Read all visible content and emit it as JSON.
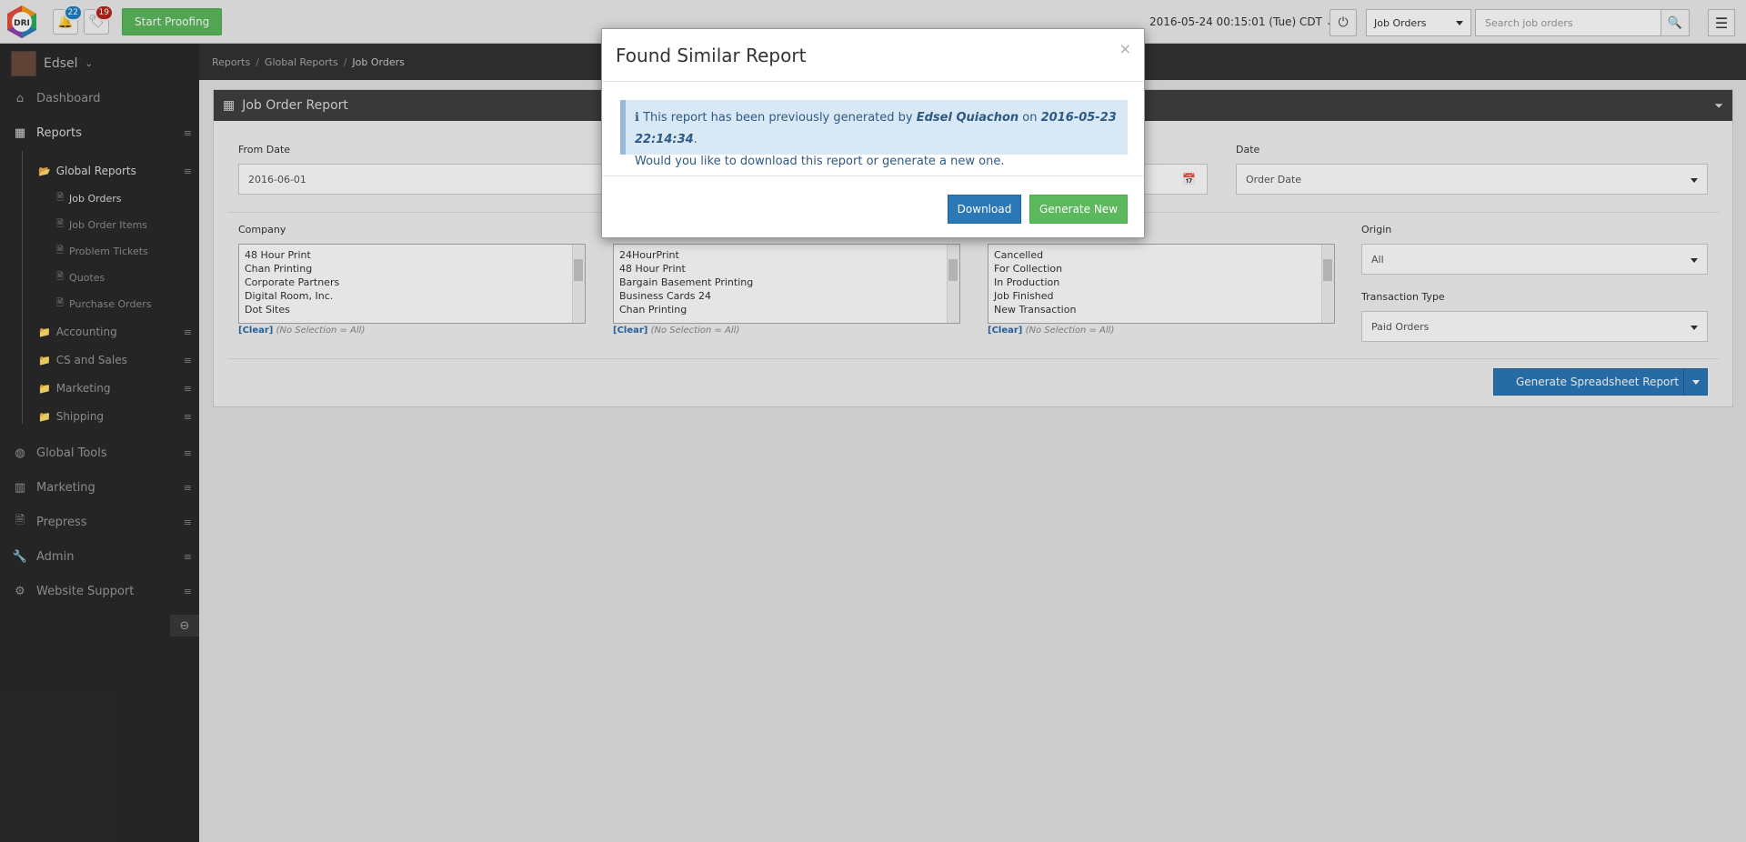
{
  "topbar": {
    "logo_text": "DRI",
    "notifications_count": "22",
    "tasks_count": "19",
    "start_proofing_label": "Start Proofing",
    "datetime": "2016-05-24 00:15:01 (Tue) CDT",
    "search_scope": "Job Orders",
    "search_placeholder": "Search job orders",
    "badge_blue": "#1f7fc4",
    "badge_red": "#b5241b"
  },
  "sidebar": {
    "user_name": "Edsel",
    "items": [
      {
        "label": "Dashboard",
        "icon": "home-icon"
      },
      {
        "label": "Reports",
        "icon": "table-icon"
      },
      {
        "label": "Global Tools",
        "icon": "globe-icon"
      },
      {
        "label": "Marketing",
        "icon": "bar-chart-icon"
      },
      {
        "label": "Prepress",
        "icon": "file-icon"
      },
      {
        "label": "Admin",
        "icon": "wrench-icon"
      },
      {
        "label": "Website Support",
        "icon": "gear-icon"
      }
    ],
    "report_groups": [
      {
        "label": "Global Reports"
      },
      {
        "label": "Accounting"
      },
      {
        "label": "CS and Sales"
      },
      {
        "label": "Marketing"
      },
      {
        "label": "Shipping"
      }
    ],
    "global_reports": [
      {
        "label": "Job Orders"
      },
      {
        "label": "Job Order Items"
      },
      {
        "label": "Problem Tickets"
      },
      {
        "label": "Quotes"
      },
      {
        "label": "Purchase Orders"
      }
    ]
  },
  "breadcrumb": [
    "Reports",
    "Global Reports",
    "Job Orders"
  ],
  "panel": {
    "title": "Job Order Report",
    "from_date_label": "From Date",
    "from_date_value": "2016-06-01",
    "date_label": "Date",
    "date_value": "Order Date",
    "company_label": "Company",
    "company_list": [
      "48 Hour Print",
      "Chan Printing",
      "Corporate Partners",
      "Digital Room, Inc.",
      "Dot Sites"
    ],
    "site_list": [
      "24HourPrint",
      "48 Hour Print",
      "Bargain Basement Printing",
      "Business Cards 24",
      "Chan Printing"
    ],
    "status_list": [
      "Cancelled",
      "For Collection",
      "In Production",
      "Job Finished",
      "New Transaction"
    ],
    "clear_label": "[Clear]",
    "clear_hint": "(No Selection = All)",
    "origin_label": "Origin",
    "origin_value": "All",
    "transaction_type_label": "Transaction Type",
    "transaction_type_value": "Paid Orders",
    "generate_label": "Generate Spreadsheet Report"
  },
  "modal": {
    "title": "Found Similar Report",
    "close": "×",
    "message_prefix": "This report has been previously generated by",
    "user": "Edsel Quiachon",
    "on": "on",
    "timestamp": "2016-05-23 22:14:34",
    "line2": "Would you like to download this report or generate a new one.",
    "download_label": "Download",
    "generate_new_label": "Generate New"
  }
}
